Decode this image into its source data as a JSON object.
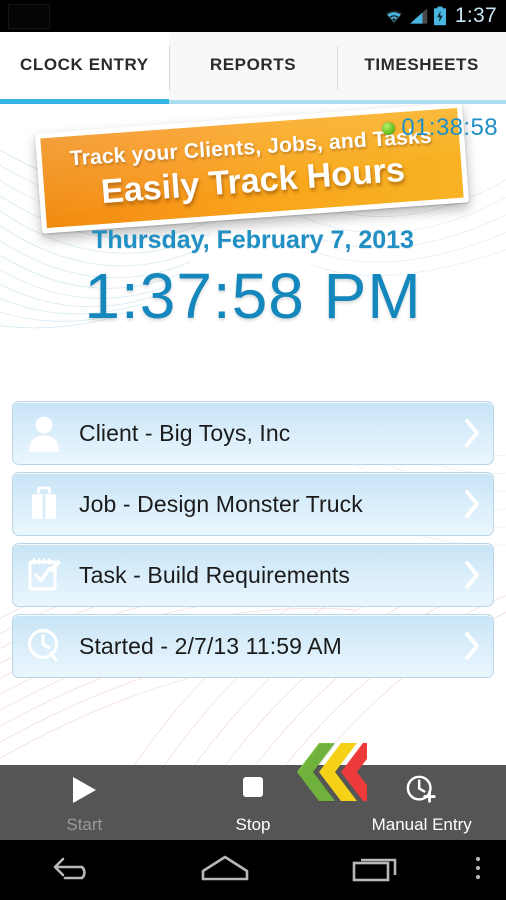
{
  "statusbar": {
    "clock": "1:37",
    "icons": [
      "wifi-icon",
      "cellular-signal-icon",
      "battery-charging-icon"
    ]
  },
  "tabs": [
    {
      "label": "CLOCK ENTRY",
      "active": true
    },
    {
      "label": "REPORTS",
      "active": false
    },
    {
      "label": "TIMESHEETS",
      "active": false
    }
  ],
  "banner": {
    "line1": "Track your Clients, Jobs, and Tasks",
    "line2": "Easily Track Hours",
    "color_start": "#f08a0e",
    "color_end": "#f8b324"
  },
  "session": {
    "elapsed": "01:38:58",
    "status_color": "#5fbd1c"
  },
  "clock": {
    "date": "Thursday, February 7, 2013",
    "time": "1:37:58 PM",
    "accent_color": "#1487bd"
  },
  "entry_rows": [
    {
      "icon": "person-icon",
      "label": "Client - Big Toys, Inc"
    },
    {
      "icon": "briefcase-icon",
      "label": "Job - Design Monster Truck"
    },
    {
      "icon": "checklist-icon",
      "label": "Task - Build Requirements"
    },
    {
      "icon": "clock-icon",
      "label": "Started - 2/7/13 11:59 AM"
    }
  ],
  "toolbar": {
    "start_label": "Start",
    "stop_label": "Stop",
    "manual_label": "Manual Entry",
    "logo_colors": [
      "#7ac142",
      "#f5d218",
      "#ed3a3a"
    ]
  },
  "navbar": {
    "back": "back-icon",
    "home": "home-icon",
    "recents": "recents-icon",
    "overflow": "overflow-menu-icon"
  }
}
